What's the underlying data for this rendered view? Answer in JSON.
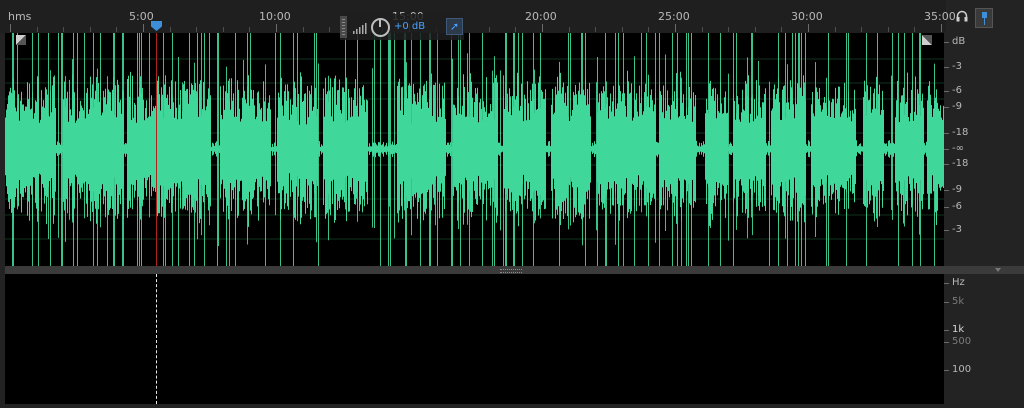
{
  "time_ruler": {
    "unit": "hms",
    "labels": [
      "5:00",
      "10:00",
      "15:00",
      "20:00",
      "25:00",
      "30:00",
      "35:00"
    ]
  },
  "hud": {
    "gain": "+0 dB"
  },
  "amplitude_ruler": {
    "labels": [
      "dB",
      "-3",
      "-6",
      "-9",
      "-18",
      "-∞",
      "-18",
      "-9",
      "-6",
      "-3"
    ]
  },
  "frequency_ruler": {
    "labels": [
      "Hz",
      "5k",
      "1k",
      "500",
      "100"
    ]
  },
  "colors": {
    "waveform": "#3fd89a",
    "cursor": "#b32020",
    "playhead": "#3c8fd8",
    "gain_text": "#4aa3ff"
  },
  "icons": {
    "headphones": "headphones-icon",
    "snap": "pin-icon",
    "hud_pin": "pin-icon"
  }
}
